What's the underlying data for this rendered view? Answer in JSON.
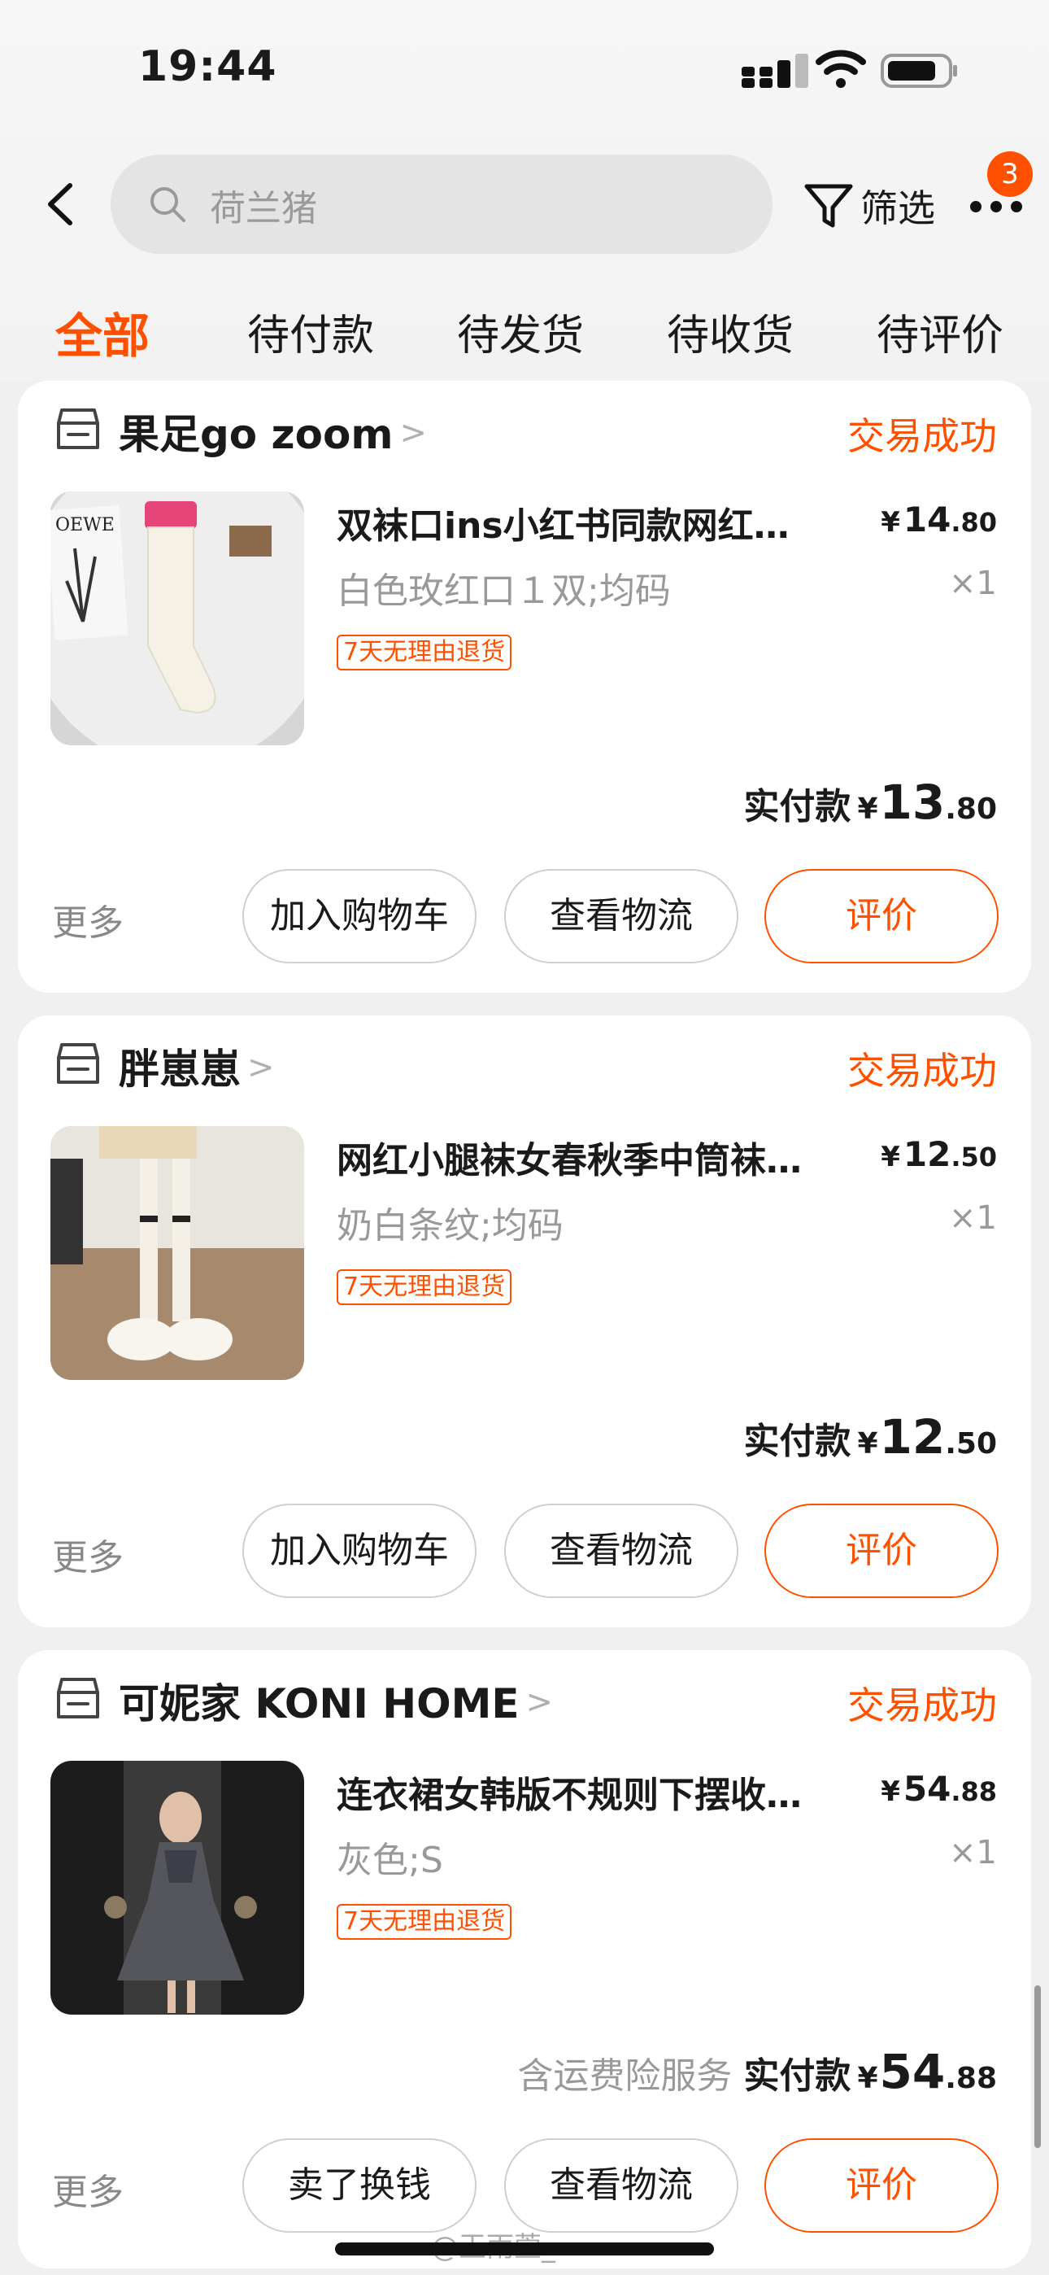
{
  "status_bar": {
    "time": "19:44"
  },
  "header": {
    "search_placeholder": "荷兰猪",
    "filter_label": "筛选",
    "more_badge": "3"
  },
  "tabs": [
    "全部",
    "待付款",
    "待发货",
    "待收货",
    "待评价"
  ],
  "orders": [
    {
      "shop": "果足go zoom",
      "status": "交易成功",
      "title": "双袜口ins小红书同款网红…",
      "price_int": "14",
      "price_dec": ".80",
      "sku": "白色玫红口１双;均码",
      "qty": "×1",
      "tag": "7天无理由退货",
      "service": "",
      "paid_label": "实付款",
      "paid_int": "13",
      "paid_dec": ".80",
      "more": "更多",
      "buttons": [
        "加入购物车",
        "查看物流",
        "评价"
      ]
    },
    {
      "shop": "胖崽崽",
      "status": "交易成功",
      "title": "网红小腿袜女春秋季中筒袜…",
      "price_int": "12",
      "price_dec": ".50",
      "sku": "奶白条纹;均码",
      "qty": "×1",
      "tag": "7天无理由退货",
      "service": "",
      "paid_label": "实付款",
      "paid_int": "12",
      "paid_dec": ".50",
      "more": "更多",
      "buttons": [
        "加入购物车",
        "查看物流",
        "评价"
      ]
    },
    {
      "shop": "可妮家 KONI HOME",
      "status": "交易成功",
      "title": "连衣裙女韩版不规则下摆收…",
      "price_int": "54",
      "price_dec": ".88",
      "sku": "灰色;S",
      "qty": "×1",
      "tag": "7天无理由退货",
      "service": "含运费险服务",
      "paid_label": "实付款",
      "paid_int": "54",
      "paid_dec": ".88",
      "more": "更多",
      "buttons": [
        "卖了换钱",
        "查看物流",
        "评价"
      ]
    }
  ],
  "currency": "¥",
  "watermark": "@王雨萱_",
  "colors": {
    "accent": "#ff5000",
    "background": "#f0f0f0",
    "card": "#ffffff"
  }
}
